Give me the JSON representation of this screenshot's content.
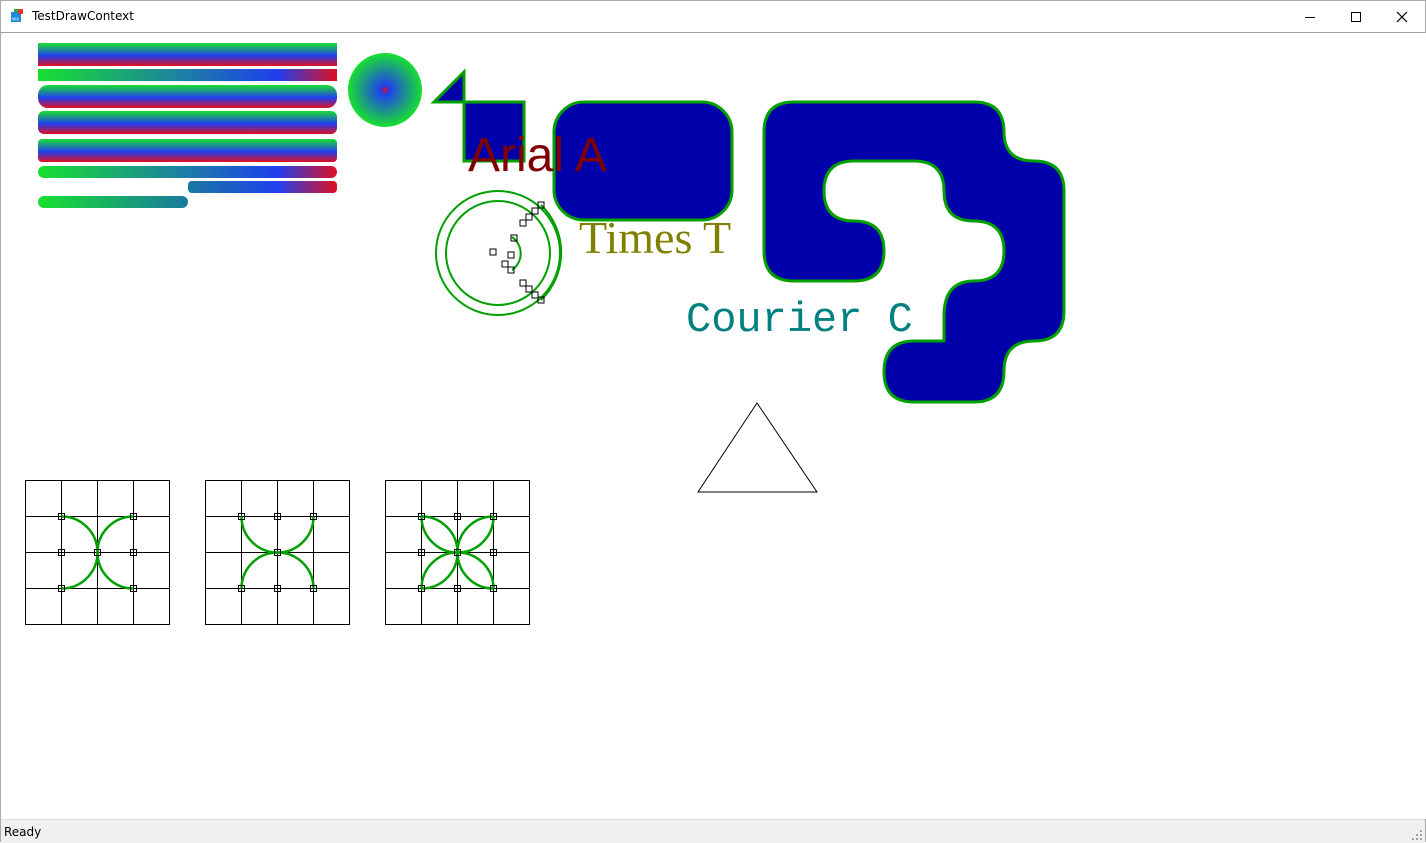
{
  "window": {
    "title": "TestDrawContext",
    "controls": {
      "minimize": "minimize",
      "maximize": "maximize",
      "close": "close"
    }
  },
  "canvas": {
    "texts": {
      "arial": "Arial A",
      "times": "Times T",
      "courier": "Courier C"
    },
    "colors": {
      "arial": "#800000",
      "times": "#808000",
      "courier": "#008080",
      "fill_blue": "#0000aa",
      "outline_green": "#00a000",
      "gradient_green": "#18e030",
      "gradient_blue": "#2040f0",
      "gradient_red": "#e01020"
    }
  },
  "status": {
    "text": "Ready"
  }
}
